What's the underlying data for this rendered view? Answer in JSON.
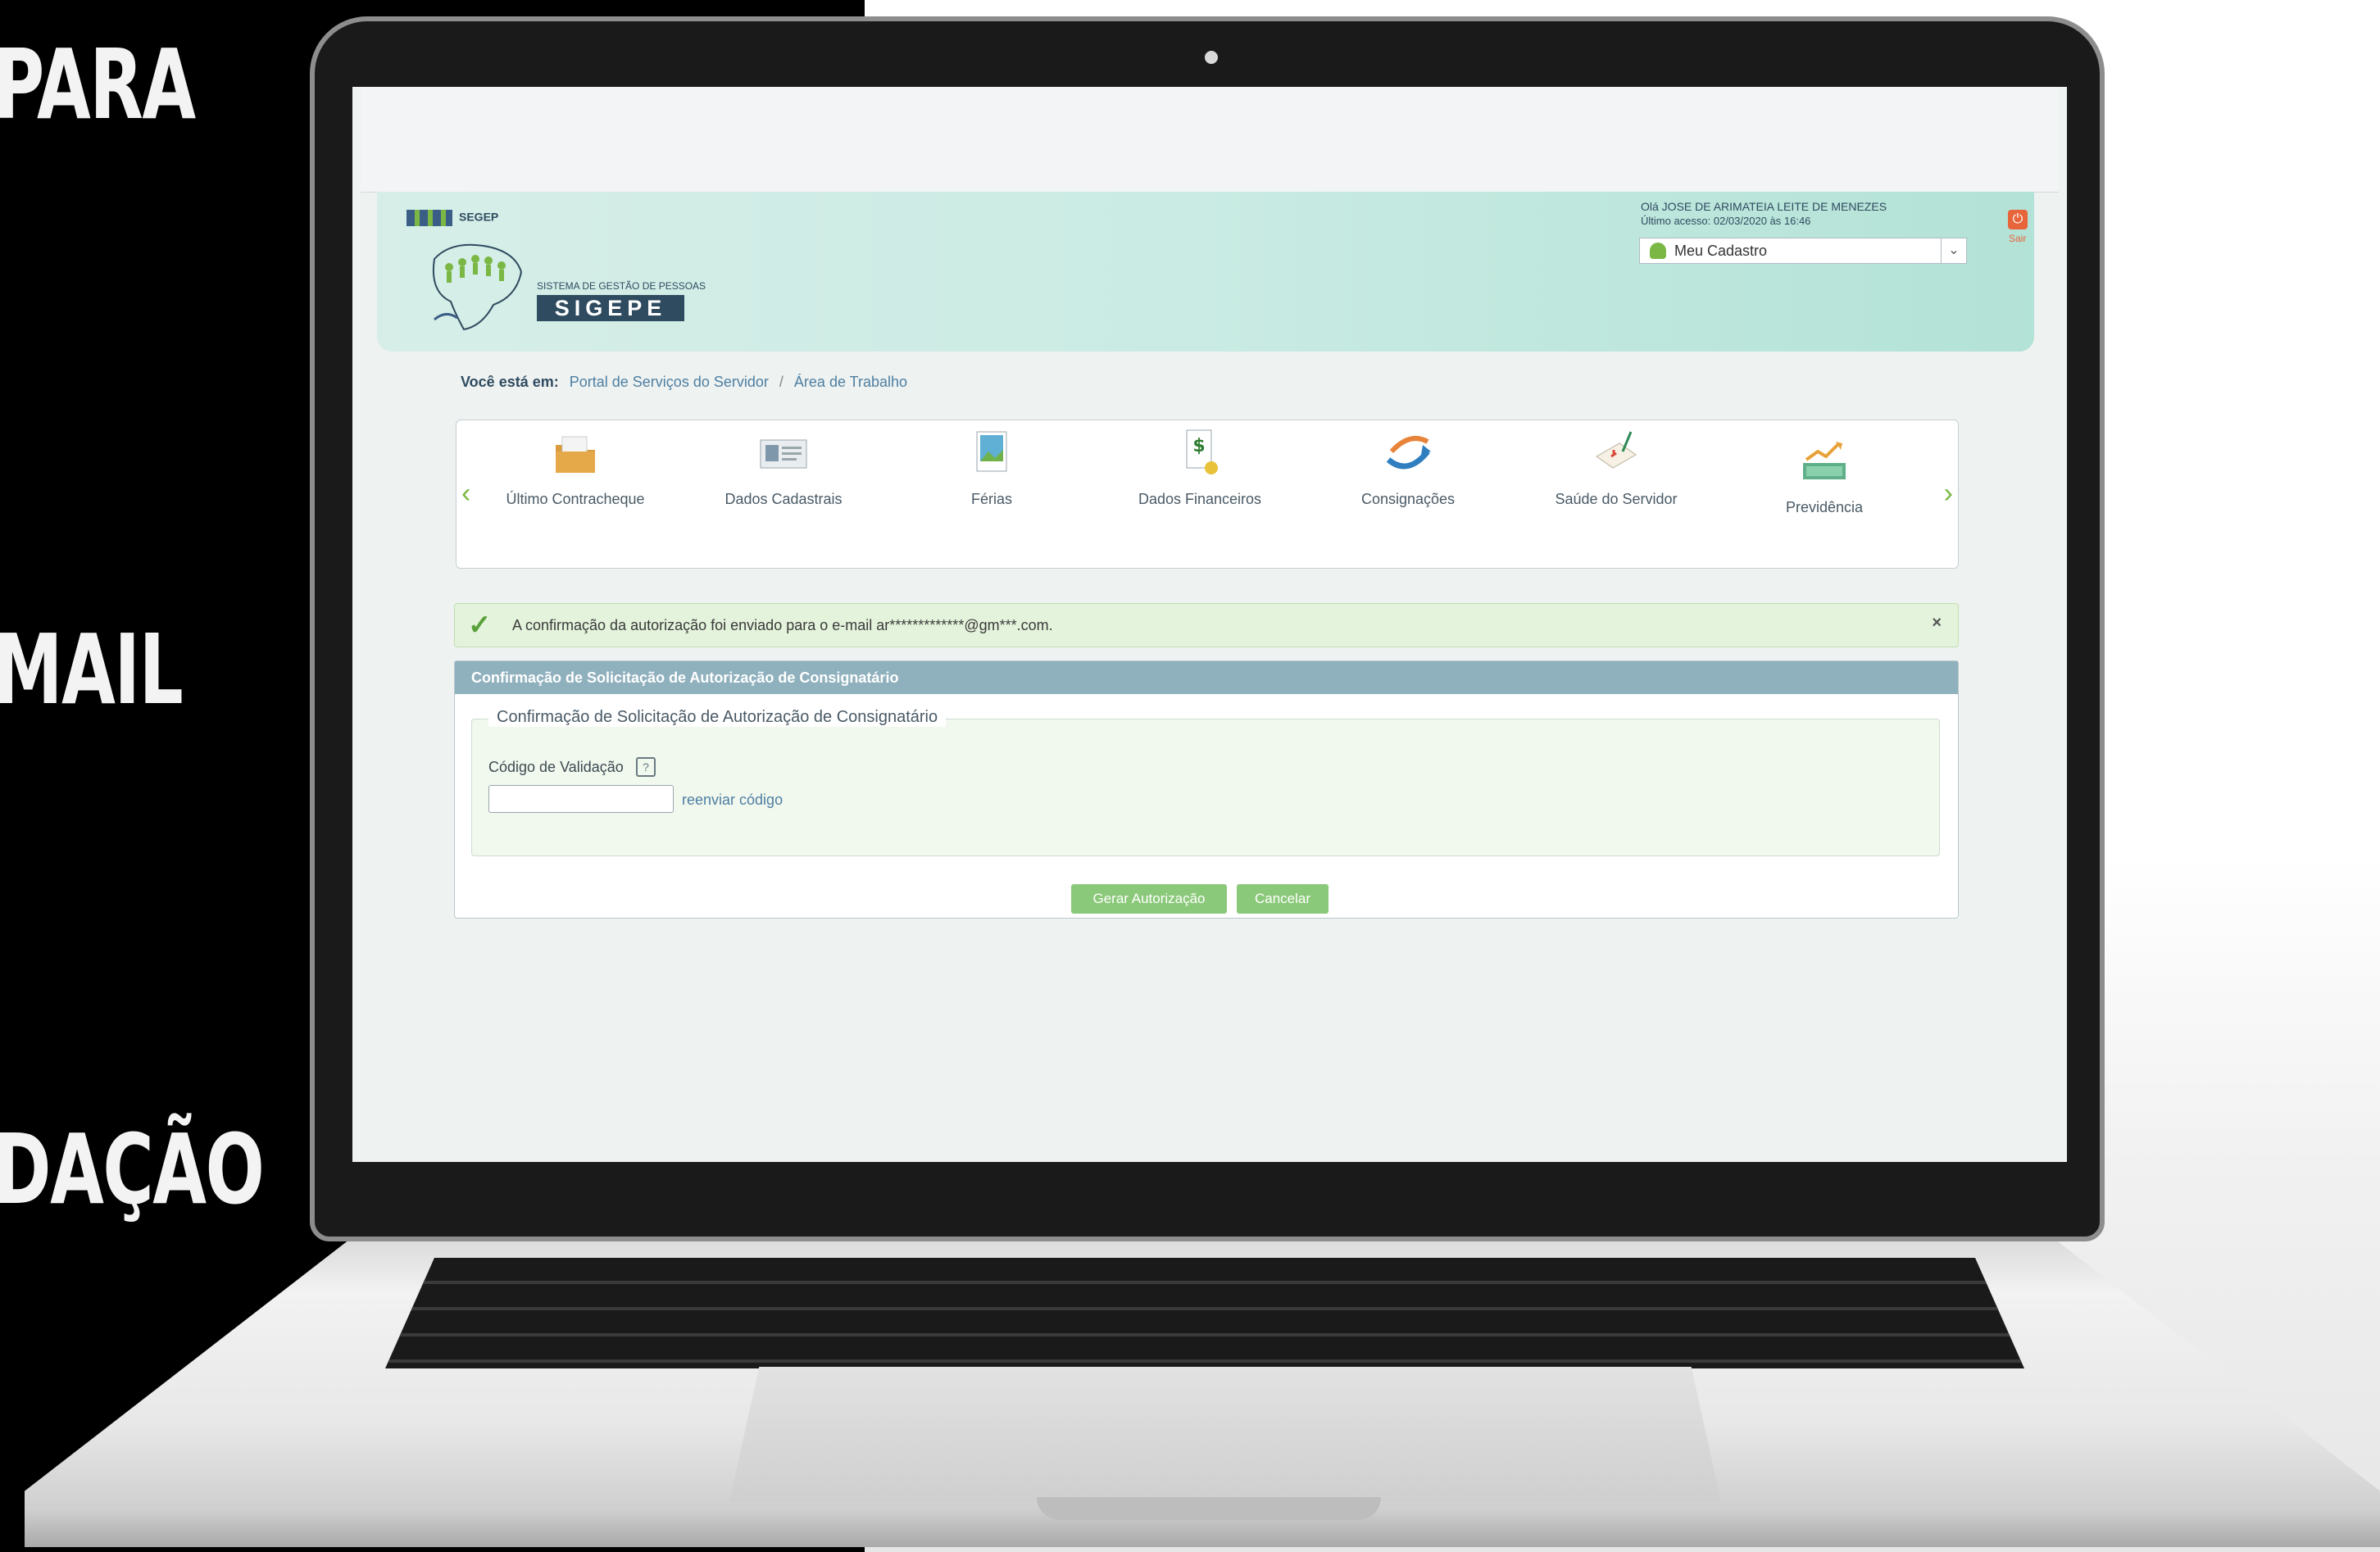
{
  "side_text": [
    "PARA",
    "MAIL",
    "DAÇÃO"
  ],
  "header": {
    "org": "SEGEP",
    "system_name": "SISTEMA DE GESTÃO DE PESSOAS",
    "system_brand": "SIGEPE",
    "greeting": "Olá JOSE DE ARIMATEIA LEITE DE MENEZES",
    "last_access": "Último acesso: 02/03/2020 às 16:46",
    "profile_menu": "Meu Cadastro",
    "logout_label": "Sair"
  },
  "breadcrumb": {
    "label": "Você está em:",
    "items": [
      "Portal de Serviços do Servidor",
      "Área de Trabalho"
    ],
    "separator": "/"
  },
  "icon_bar": {
    "items": [
      {
        "label": "Último Contracheque",
        "icon": "folder-icon"
      },
      {
        "label": "Dados Cadastrais",
        "icon": "id-card-icon"
      },
      {
        "label": "Férias",
        "icon": "vacation-photo-icon"
      },
      {
        "label": "Dados Financeiros",
        "icon": "money-document-icon"
      },
      {
        "label": "Consignações",
        "icon": "arrow-loop-icon"
      },
      {
        "label": "Saúde do Servidor",
        "icon": "health-checklist-icon"
      },
      {
        "label": "Previdência",
        "icon": "growth-money-icon"
      }
    ]
  },
  "alert": {
    "message": "A confirmação da autorização foi enviado para o e-mail ar*************@gm***.com.",
    "close": "×"
  },
  "panel": {
    "title": "Confirmação de Solicitação de Autorização de Consignatário",
    "legend": "Confirmação de Solicitação de Autorização de Consignatário",
    "field_label": "Código de Validação",
    "code_value": "",
    "resend_link": "reenviar código",
    "submit_button": "Gerar Autorização",
    "cancel_button": "Cancelar"
  },
  "colors": {
    "accent_green": "#8bc97a",
    "header_teal": "#b3e2d6",
    "panel_header": "#8fb0bd",
    "link_blue": "#4e7fa2"
  }
}
